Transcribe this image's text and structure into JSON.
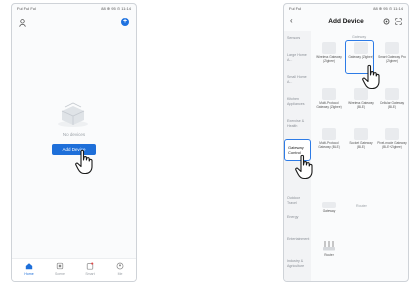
{
  "left_phone": {
    "status_left": "Ful Ful Ful",
    "status_right": "88 ⊕ 95 ⊙ 11:14",
    "no_devices_text": "No devices",
    "add_device_label": "Add Device",
    "tabs": [
      {
        "label": "Home",
        "icon": "home-icon",
        "active": true
      },
      {
        "label": "Scene",
        "icon": "scene-icon",
        "active": false
      },
      {
        "label": "Smart",
        "icon": "smart-icon",
        "active": false
      },
      {
        "label": "Me",
        "icon": "me-icon",
        "active": false
      }
    ]
  },
  "right_phone": {
    "status_left": "Ful Ful",
    "status_right": "88 ⊕ 95 ⊙ 11:14",
    "title": "Add Device",
    "categories": [
      {
        "label": "Sensors",
        "top": 0
      },
      {
        "label": "Large Home A...",
        "top": 0
      },
      {
        "label": "Small Home A...",
        "top": 0
      },
      {
        "label": "Kitchen Appliances",
        "top": 0
      },
      {
        "label": "Exercise & Health",
        "top": 0
      },
      {
        "label": "Security & Video S...",
        "top": 0
      },
      {
        "label": "Outdoor Travel",
        "top": 0
      },
      {
        "label": "Energy",
        "top": 0
      },
      {
        "label": "Entertainment",
        "top": 0
      },
      {
        "label": "Industry & Agriculture",
        "top": 0
      }
    ],
    "selected_category": "Gateway Control",
    "section_gateway": "Gateway",
    "section_bottom": "Router",
    "items_row1": [
      "Wireless Gateway (Zigbee)",
      "Gateway (Zigbee)",
      "Smart Gateway Pro (Zigbee)"
    ],
    "items_row2": [
      "Multi-Protocol Gateway (Zigbee)",
      "Wireless Gateway (BLE)",
      "Cellular Gateway (BLE)"
    ],
    "items_row3": [
      "Multi-Protocol Gateway (BLE)",
      "Socket Gateway (BLE)",
      "Pixel-mode Gateway (BLE+Zigbee)"
    ],
    "item_single": "Gateway",
    "item_router": "Router",
    "accent_color": "#1e6fd9"
  }
}
